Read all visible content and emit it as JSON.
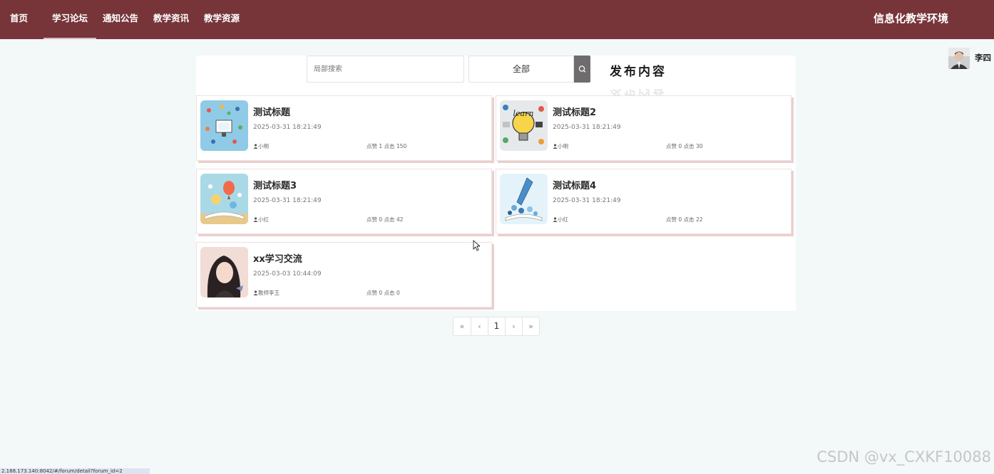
{
  "nav": {
    "items": [
      {
        "label": "首页",
        "active": false
      },
      {
        "label": "学习论坛",
        "active": true
      },
      {
        "label": "通知公告",
        "active": false
      },
      {
        "label": "教学资讯",
        "active": false
      },
      {
        "label": "教学资源",
        "active": false
      }
    ],
    "brand": "信息化教学环境"
  },
  "user": {
    "name": "李四"
  },
  "search": {
    "placeholder": "局部搜索",
    "select_value": "全部",
    "search_icon": "search-icon"
  },
  "publish_label": "发布内容",
  "posts": [
    {
      "title": "测试标题",
      "date": "2025-03-31 18:21:49",
      "author": "小明",
      "likes_label": "点赞",
      "likes": "1",
      "clicks_label": "点击",
      "clicks": "150"
    },
    {
      "title": "测试标题2",
      "date": "2025-03-31 18:21:49",
      "author": "小明",
      "likes_label": "点赞",
      "likes": "0",
      "clicks_label": "点击",
      "clicks": "30"
    },
    {
      "title": "测试标题3",
      "date": "2025-03-31 18:21:49",
      "author": "小红",
      "likes_label": "点赞",
      "likes": "0",
      "clicks_label": "点击",
      "clicks": "42"
    },
    {
      "title": "测试标题4",
      "date": "2025-03-31 18:21:49",
      "author": "小红",
      "likes_label": "点赞",
      "likes": "0",
      "clicks_label": "点击",
      "clicks": "22"
    },
    {
      "title": "xx学习交流",
      "date": "2025-03-03 10:44:09",
      "author": "教师李王",
      "likes_label": "点赞",
      "likes": "0",
      "clicks_label": "点击",
      "clicks": "0"
    }
  ],
  "pagination": {
    "first": "«",
    "prev": "‹",
    "current": "1",
    "next": "›",
    "last": "»"
  },
  "status_url": "2.188.173.140:8042/#/forum/detail?forum_id=2",
  "watermark": "CSDN @vx_CXKF10088",
  "colors": {
    "nav_bg": "#773539",
    "page_bg": "#f3f8f9",
    "card_shadow": "#ebcfcf",
    "search_btn": "#6f6c6e"
  }
}
